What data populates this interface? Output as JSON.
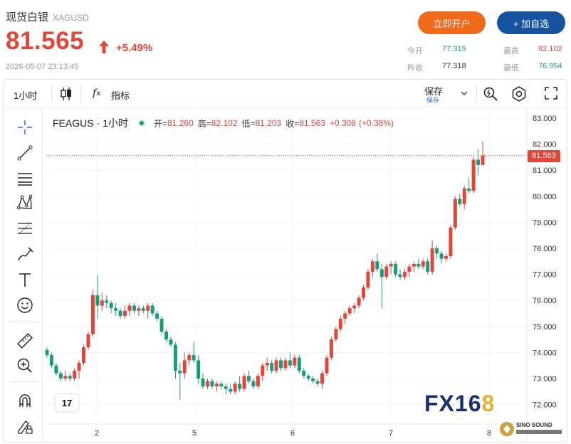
{
  "header": {
    "name": "现货白银",
    "code": "XAGUSD",
    "price": "81.565",
    "change_pct": "+5.49%",
    "timestamp": "2026-05-07 23:13:45",
    "open_account_label": "立即开户",
    "add_watch_label": "+ 加自选",
    "stats": {
      "today_open_label": "今开",
      "today_open": "77.315",
      "high_label": "最高",
      "high": "82.102",
      "prev_close_label": "昨收",
      "prev_close": "77.318",
      "low_label": "最低",
      "low": "76.954"
    }
  },
  "toolbar": {
    "interval": "1小时",
    "indicators_label": "指标",
    "save_label": "保存",
    "save_sub_label": "保存"
  },
  "legend": {
    "symbol": "FEAGUS",
    "interval": "1小时",
    "open_label": "开=",
    "open": "81.260",
    "high_label": "高=",
    "high": "82.102",
    "low_label": "低=",
    "low": "81.203",
    "close_label": "收=",
    "close": "81.563",
    "change": "+0.308",
    "change_pct": "(+0.38%)"
  },
  "last_price_tag": "81.563",
  "watermark": {
    "fx": "FX",
    "num": "16",
    "eight": "8",
    "sino": "SINO SOUND"
  },
  "tv_logo": "17",
  "colors": {
    "up": "#e0463a",
    "down": "#1a9b7c",
    "accent_orange": "#f06a1c",
    "accent_blue": "#16539e"
  },
  "chart_data": {
    "type": "candlestick",
    "y_ticks": [
      "83.000",
      "82.000",
      "81.000",
      "80.000",
      "79.000",
      "78.000",
      "77.000",
      "76.000",
      "75.000",
      "74.000",
      "73.000",
      "72.000"
    ],
    "x_ticks": [
      "2",
      "5",
      "6",
      "7",
      "8"
    ],
    "ylim": [
      71.5,
      83.25
    ],
    "last_price": 81.563,
    "candles": [
      {
        "o": 74.1,
        "h": 74.2,
        "l": 73.8,
        "c": 73.9
      },
      {
        "o": 73.9,
        "h": 74.0,
        "l": 73.4,
        "c": 73.5
      },
      {
        "o": 73.5,
        "h": 73.6,
        "l": 73.1,
        "c": 73.2
      },
      {
        "o": 73.2,
        "h": 73.3,
        "l": 72.9,
        "c": 73.0
      },
      {
        "o": 73.0,
        "h": 73.3,
        "l": 72.9,
        "c": 73.1
      },
      {
        "o": 73.1,
        "h": 73.2,
        "l": 72.9,
        "c": 73.0
      },
      {
        "o": 73.0,
        "h": 73.4,
        "l": 72.9,
        "c": 73.3
      },
      {
        "o": 73.3,
        "h": 73.7,
        "l": 73.0,
        "c": 73.6
      },
      {
        "o": 73.6,
        "h": 74.3,
        "l": 73.5,
        "c": 74.2
      },
      {
        "o": 74.2,
        "h": 74.8,
        "l": 74.1,
        "c": 74.7
      },
      {
        "o": 74.7,
        "h": 76.4,
        "l": 74.6,
        "c": 76.2
      },
      {
        "o": 76.2,
        "h": 76.96,
        "l": 75.3,
        "c": 75.8
      },
      {
        "o": 75.8,
        "h": 76.3,
        "l": 75.6,
        "c": 76.0
      },
      {
        "o": 76.0,
        "h": 76.2,
        "l": 75.7,
        "c": 75.9
      },
      {
        "o": 75.9,
        "h": 76.0,
        "l": 75.5,
        "c": 75.7
      },
      {
        "o": 75.7,
        "h": 75.9,
        "l": 75.4,
        "c": 75.6
      },
      {
        "o": 75.6,
        "h": 75.7,
        "l": 75.3,
        "c": 75.4
      },
      {
        "o": 75.4,
        "h": 75.8,
        "l": 75.3,
        "c": 75.6
      },
      {
        "o": 75.6,
        "h": 75.9,
        "l": 75.4,
        "c": 75.8
      },
      {
        "o": 75.8,
        "h": 75.9,
        "l": 75.5,
        "c": 75.6
      },
      {
        "o": 75.6,
        "h": 75.8,
        "l": 75.4,
        "c": 75.7
      },
      {
        "o": 75.7,
        "h": 75.8,
        "l": 75.5,
        "c": 75.6
      },
      {
        "o": 75.6,
        "h": 75.9,
        "l": 75.3,
        "c": 75.8
      },
      {
        "o": 75.8,
        "h": 75.9,
        "l": 75.4,
        "c": 75.5
      },
      {
        "o": 75.5,
        "h": 75.6,
        "l": 75.2,
        "c": 75.3
      },
      {
        "o": 75.3,
        "h": 75.4,
        "l": 74.7,
        "c": 74.8
      },
      {
        "o": 74.8,
        "h": 74.9,
        "l": 74.4,
        "c": 74.5
      },
      {
        "o": 74.5,
        "h": 74.6,
        "l": 74.2,
        "c": 74.3
      },
      {
        "o": 74.3,
        "h": 74.4,
        "l": 73.0,
        "c": 73.3
      },
      {
        "o": 73.3,
        "h": 73.6,
        "l": 72.2,
        "c": 73.2
      },
      {
        "o": 73.2,
        "h": 74.0,
        "l": 73.0,
        "c": 73.7
      },
      {
        "o": 73.7,
        "h": 74.0,
        "l": 73.5,
        "c": 73.9
      },
      {
        "o": 73.9,
        "h": 74.4,
        "l": 73.6,
        "c": 73.7
      },
      {
        "o": 73.7,
        "h": 73.9,
        "l": 72.8,
        "c": 73.0
      },
      {
        "o": 73.0,
        "h": 73.2,
        "l": 72.6,
        "c": 72.7
      },
      {
        "o": 72.7,
        "h": 73.0,
        "l": 72.6,
        "c": 72.9
      },
      {
        "o": 72.9,
        "h": 73.0,
        "l": 72.6,
        "c": 72.7
      },
      {
        "o": 72.7,
        "h": 72.9,
        "l": 72.5,
        "c": 72.8
      },
      {
        "o": 72.8,
        "h": 72.9,
        "l": 72.6,
        "c": 72.7
      },
      {
        "o": 72.7,
        "h": 72.8,
        "l": 72.4,
        "c": 72.6
      },
      {
        "o": 72.6,
        "h": 72.8,
        "l": 72.4,
        "c": 72.5
      },
      {
        "o": 72.5,
        "h": 72.9,
        "l": 72.4,
        "c": 72.8
      },
      {
        "o": 72.8,
        "h": 73.1,
        "l": 72.5,
        "c": 72.6
      },
      {
        "o": 72.6,
        "h": 73.2,
        "l": 72.5,
        "c": 73.1
      },
      {
        "o": 73.1,
        "h": 73.3,
        "l": 72.8,
        "c": 72.9
      },
      {
        "o": 72.9,
        "h": 73.0,
        "l": 72.6,
        "c": 72.7
      },
      {
        "o": 72.7,
        "h": 73.2,
        "l": 72.6,
        "c": 73.1
      },
      {
        "o": 73.1,
        "h": 73.6,
        "l": 72.9,
        "c": 73.5
      },
      {
        "o": 73.5,
        "h": 73.8,
        "l": 73.3,
        "c": 73.6
      },
      {
        "o": 73.6,
        "h": 73.7,
        "l": 73.2,
        "c": 73.3
      },
      {
        "o": 73.3,
        "h": 73.8,
        "l": 73.2,
        "c": 73.7
      },
      {
        "o": 73.7,
        "h": 73.8,
        "l": 73.3,
        "c": 73.4
      },
      {
        "o": 73.4,
        "h": 73.8,
        "l": 73.3,
        "c": 73.7
      },
      {
        "o": 73.7,
        "h": 74.0,
        "l": 73.4,
        "c": 73.5
      },
      {
        "o": 73.5,
        "h": 73.9,
        "l": 73.4,
        "c": 73.8
      },
      {
        "o": 73.8,
        "h": 73.9,
        "l": 73.2,
        "c": 73.3
      },
      {
        "o": 73.3,
        "h": 73.4,
        "l": 73.0,
        "c": 73.1
      },
      {
        "o": 73.1,
        "h": 73.2,
        "l": 72.9,
        "c": 73.0
      },
      {
        "o": 73.0,
        "h": 73.1,
        "l": 72.8,
        "c": 72.9
      },
      {
        "o": 72.9,
        "h": 73.0,
        "l": 72.7,
        "c": 72.8
      },
      {
        "o": 72.8,
        "h": 73.3,
        "l": 72.6,
        "c": 73.2
      },
      {
        "o": 73.2,
        "h": 73.9,
        "l": 73.1,
        "c": 73.8
      },
      {
        "o": 73.8,
        "h": 74.6,
        "l": 73.7,
        "c": 74.5
      },
      {
        "o": 74.5,
        "h": 75.0,
        "l": 74.4,
        "c": 74.9
      },
      {
        "o": 74.9,
        "h": 75.4,
        "l": 74.8,
        "c": 75.3
      },
      {
        "o": 75.3,
        "h": 75.6,
        "l": 75.1,
        "c": 75.5
      },
      {
        "o": 75.5,
        "h": 75.8,
        "l": 75.4,
        "c": 75.7
      },
      {
        "o": 75.7,
        "h": 75.9,
        "l": 75.5,
        "c": 75.8
      },
      {
        "o": 75.8,
        "h": 76.2,
        "l": 75.7,
        "c": 76.1
      },
      {
        "o": 76.1,
        "h": 76.6,
        "l": 76.0,
        "c": 76.5
      },
      {
        "o": 76.5,
        "h": 77.2,
        "l": 76.4,
        "c": 77.1
      },
      {
        "o": 77.1,
        "h": 77.6,
        "l": 76.9,
        "c": 77.5
      },
      {
        "o": 77.5,
        "h": 77.8,
        "l": 77.1,
        "c": 77.2
      },
      {
        "o": 77.2,
        "h": 77.4,
        "l": 75.7,
        "c": 76.9
      },
      {
        "o": 76.9,
        "h": 77.4,
        "l": 76.8,
        "c": 77.3
      },
      {
        "o": 77.3,
        "h": 77.5,
        "l": 77.0,
        "c": 77.4
      },
      {
        "o": 77.4,
        "h": 77.5,
        "l": 76.9,
        "c": 77.0
      },
      {
        "o": 77.0,
        "h": 77.2,
        "l": 76.8,
        "c": 76.9
      },
      {
        "o": 76.9,
        "h": 77.2,
        "l": 76.8,
        "c": 77.1
      },
      {
        "o": 77.1,
        "h": 77.4,
        "l": 76.9,
        "c": 77.3
      },
      {
        "o": 77.3,
        "h": 77.5,
        "l": 77.1,
        "c": 77.4
      },
      {
        "o": 77.4,
        "h": 77.6,
        "l": 77.2,
        "c": 77.3
      },
      {
        "o": 77.3,
        "h": 77.6,
        "l": 77.2,
        "c": 77.5
      },
      {
        "o": 77.5,
        "h": 77.6,
        "l": 77.0,
        "c": 77.1
      },
      {
        "o": 77.1,
        "h": 78.3,
        "l": 77.0,
        "c": 78.0
      },
      {
        "o": 78.0,
        "h": 78.1,
        "l": 77.6,
        "c": 77.8
      },
      {
        "o": 77.8,
        "h": 77.9,
        "l": 77.4,
        "c": 77.6
      },
      {
        "o": 77.6,
        "h": 77.8,
        "l": 77.5,
        "c": 77.7
      },
      {
        "o": 77.7,
        "h": 78.9,
        "l": 77.6,
        "c": 78.8
      },
      {
        "o": 78.8,
        "h": 80.0,
        "l": 78.7,
        "c": 79.9
      },
      {
        "o": 79.9,
        "h": 80.1,
        "l": 79.6,
        "c": 79.7
      },
      {
        "o": 79.7,
        "h": 80.4,
        "l": 79.5,
        "c": 80.3
      },
      {
        "o": 80.3,
        "h": 80.7,
        "l": 80.1,
        "c": 80.2
      },
      {
        "o": 80.2,
        "h": 81.5,
        "l": 80.1,
        "c": 81.4
      },
      {
        "o": 81.4,
        "h": 81.8,
        "l": 80.8,
        "c": 81.2
      },
      {
        "o": 81.2,
        "h": 82.1,
        "l": 81.2,
        "c": 81.56
      }
    ]
  }
}
